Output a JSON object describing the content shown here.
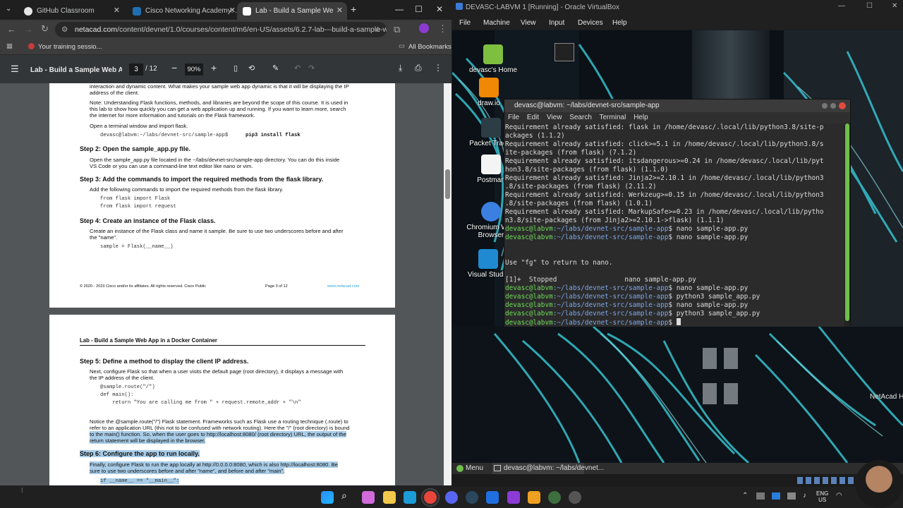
{
  "browser": {
    "tabs": [
      {
        "label": "GitHub Classroom",
        "color": "#e6e6e6"
      },
      {
        "label": "Cisco Networking Academy: ...",
        "color": "#1f6fb2"
      },
      {
        "label": "Lab - Build a Sample Web App...",
        "color": "#ffffff"
      }
    ],
    "url_prefix": "netacad.com",
    "url_rest": "/content/devnet/1.0/courses/content/m6/en-US/assets/6.2.7-lab---build-a-sample-w...",
    "bookmark": "Your training sessio...",
    "all_bookmarks": "All Bookmarks"
  },
  "pdf": {
    "title": "Lab - Build a Sample Web A...",
    "page_current": "3",
    "page_total": "/ 12",
    "zoom": "90%",
    "page3": {
      "intro1": "interaction and dynamic content. What makes your sample web app dynamic is that it will be displaying the IP",
      "intro2": "address of the client.",
      "note1": "Note: Understanding Flask functions, methods, and libraries are beyond the scope of this course. It is used in",
      "note2": "this lab to show how quickly you can get a web application up and running. If you want to learn more, search",
      "note3": "the internet for more information and tutorials on the Flask framework.",
      "open_term": "Open a terminal window and import flask.",
      "cmd_prompt": "devasc@labvm:~/labs/devnet-src/sample-app$",
      "cmd": "pip3 install flask",
      "step2": "Step 2: Open the sample_app.py file.",
      "step2_t1": "Open the sample_app.py file located in the ~/labs/devnet-src/sample-app directory. You can do this inside",
      "step2_t2": "VS Code or you can use a command-line text editor like nano or vim.",
      "step3": "Step 3: Add the commands to import the required methods from the flask library.",
      "step3_t": "Add the following commands to import the required methods from the flask library.",
      "code1": "from flask import Flask",
      "code2": "from flask import request",
      "step4": "Step 4: Create an instance of the Flask class.",
      "step4_t1": "Create an instance of the Flask class and name it sample. Be sure to use two underscores before and after",
      "step4_t2": "the \"name\".",
      "code3": "sample = Flask(__name__)",
      "footer_left": "© 2020 - 2023 Cisco and/or its affiliates. All rights reserved. Cisco Public",
      "footer_mid": "Page 3 of 12",
      "footer_right": "www.netacad.com"
    },
    "page4": {
      "header": "Lab - Build a Sample Web App in a Docker Container",
      "step5": "Step 5: Define a method to display the client IP address.",
      "step5_t1": "Next, configure Flask so that when a user visits the default page (root directory), it displays a message with",
      "step5_t2": "the IP address of the client.",
      "code1": "@sample.route(\"/\")",
      "code2": "def main():",
      "code3": "    return \"You are calling me from \" + request.remote_addr + \"\\n\"",
      "notice1": "Notice the @sample.route(\"/\") Flask statement. Frameworks such as Flask use a routing technique (.route) to",
      "notice2": "refer to an application URL (this not to be confused with network routing). Here the \"/\" (root directory) is bound",
      "notice3": "to the main() function. So, when the user goes to http://localhost:8080/ (root directory) URL, the output of the",
      "notice4": "return statement will be displayed in the browser.",
      "step6": "Step 6:  Configure the app to run locally.",
      "step6_t1": "Finally, configure Flask to run the app locally at http://0.0.0.0:8080, which is also http://localhost:8080. Be",
      "step6_t2": "sure to use two underscores before and after \"name\", and before and after \"main\".",
      "code4": "if __name__ == \"__main__\":"
    }
  },
  "vbox": {
    "title": "DEVASC-LABVM 1 [Running] - Oracle VirtualBox",
    "menu": [
      "File",
      "Machine",
      "View",
      "Input",
      "Devices",
      "Help"
    ],
    "desktop_icons": [
      "devasc's Home",
      "draw.io",
      "Packet Tracer",
      "Postman",
      "Chromium Web Browser",
      "Visual Studio"
    ],
    "terminal": {
      "title": "devasc@labvm: ~/labs/devnet-src/sample-app",
      "menu": [
        "File",
        "Edit",
        "View",
        "Search",
        "Terminal",
        "Help"
      ],
      "lines": [
        "Requirement already satisfied: flask in /home/devasc/.local/lib/python3.8/site-p",
        "ackages (1.1.2)",
        "Requirement already satisfied: click>=5.1 in /home/devasc/.local/lib/python3.8/s",
        "ite-packages (from flask) (7.1.2)",
        "Requirement already satisfied: itsdangerous>=0.24 in /home/devasc/.local/lib/pyt",
        "hon3.8/site-packages (from flask) (1.1.0)",
        "Requirement already satisfied: Jinja2>=2.10.1 in /home/devasc/.local/lib/python3",
        ".8/site-packages (from flask) (2.11.2)",
        "Requirement already satisfied: Werkzeug>=0.15 in /home/devasc/.local/lib/python3",
        ".8/site-packages (from flask) (1.0.1)",
        "Requirement already satisfied: MarkupSafe>=0.23 in /home/devasc/.local/lib/pytho",
        "n3.8/site-packages (from Jinja2>=2.10.1->flask) (1.1.1)"
      ],
      "prompt_user": "devasc@labvm",
      "prompt_path": ":~/labs/devnet-src/sample-app",
      "cmds": [
        "nano sample-app.py",
        "nano sample-app.py",
        "",
        "",
        "Use \"fg\" to return to nano.",
        "",
        "[1]+  Stopped                 nano sample-app.py",
        "nano sample-app.py",
        "python3 sample_app.py",
        "nano sample-app.py",
        "python3 sample_app.py",
        ""
      ]
    },
    "vm_taskbar_menu": "Menu",
    "vm_taskbar_item": "devasc@labvm: ~/labs/devnet...",
    "wallpaper_label": "NetAcad H"
  },
  "windows": {
    "lang": "ENG",
    "region": "US"
  }
}
